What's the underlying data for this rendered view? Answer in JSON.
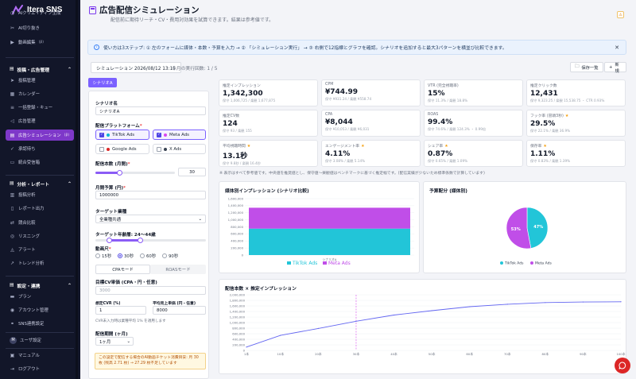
{
  "app": {
    "name": "Itera SNS"
  },
  "sidebar": {
    "top_items": [
      {
        "label": "AIクリエイティブ生成",
        "icon": "chat-icon"
      },
      {
        "label": "AI切り抜き",
        "icon": "scissors-icon"
      },
      {
        "label": "動画編集",
        "badge": "β",
        "icon": "video-icon"
      }
    ],
    "section1": {
      "label": "投稿・広告管理",
      "items": [
        {
          "label": "投稿管理",
          "icon": "send-icon"
        },
        {
          "label": "カレンダー",
          "icon": "calendar-icon"
        },
        {
          "label": "一括登録・キュー",
          "icon": "list-icon"
        },
        {
          "label": "広告管理",
          "icon": "megaphone-icon"
        },
        {
          "label": "広告シミュレーション",
          "badge": "β",
          "icon": "calculator-icon",
          "active": true
        },
        {
          "label": "承認待ち",
          "icon": "check-icon"
        },
        {
          "label": "統合受信箱",
          "icon": "inbox-icon"
        }
      ]
    },
    "section2": {
      "label": "分析・レポート",
      "items": [
        {
          "label": "投稿分析",
          "icon": "chart-icon"
        },
        {
          "label": "レポート出力",
          "icon": "file-icon"
        },
        {
          "label": "競合比較",
          "icon": "compare-icon"
        },
        {
          "label": "リスニング",
          "icon": "ear-icon"
        },
        {
          "label": "アラート",
          "icon": "bell-icon"
        },
        {
          "label": "トレンド分析",
          "icon": "trend-icon"
        }
      ]
    },
    "section3": {
      "label": "設定・連携",
      "items": [
        {
          "label": "プラン",
          "icon": "card-icon"
        },
        {
          "label": "アカウント管理",
          "icon": "user-icon"
        },
        {
          "label": "SNS連携設定",
          "icon": "link-icon"
        }
      ]
    },
    "user": {
      "initial": "M",
      "label": "ユーザ設定"
    },
    "bottom": [
      {
        "label": "マニュアル",
        "icon": "book-icon"
      },
      {
        "label": "ログアウト",
        "icon": "logout-icon"
      }
    ]
  },
  "header": {
    "title": "広告配信シミュレーション",
    "subtitle": "配信前に期待リーチ・CV・費用対効果を試算できます。結果は参考値です。"
  },
  "info": {
    "text": "使い方は3ステップ: ① 左のフォームに媒体・本数・予算を入力 → ② 「シミュレーション実行」 → ③ 右側で12指標とグラフを確認。シナリオを追加すると最大3パターンを横並び比較できます。"
  },
  "toolbar": {
    "sim_name": "シミュレーション 2026/08/12 13:15",
    "exec_count": "今月の実行回数: 1 / 5",
    "save": "保存一覧",
    "new": "新規"
  },
  "scenario_tab": "シナリオA",
  "form": {
    "scenario_name_label": "シナリオ名",
    "scenario_name": "シナリオA",
    "platform_label": "配信プラットフォーム",
    "platforms": [
      {
        "name": "TikTok Ads",
        "checked": true,
        "color": "#06b6d4"
      },
      {
        "name": "Meta Ads",
        "checked": true,
        "color": "#d946ef"
      },
      {
        "name": "Google Ads",
        "checked": false,
        "color": "#dc2626"
      },
      {
        "name": "X Ads",
        "checked": false,
        "color": "#374151"
      }
    ],
    "count_label": "配信本数 (月間)",
    "count_value": "30",
    "count_level": 0.3,
    "budget_label": "月間予算 (円)",
    "budget_value": "1000000",
    "industry_label": "ターゲット業種",
    "industry_value": "全業種共通",
    "age_label": "ターゲット年齢層: 24〜44歳",
    "age_range": [
      0.12,
      0.4
    ],
    "duration_label": "動画尺",
    "durations": [
      "15秒",
      "30秒",
      "60秒",
      "90秒"
    ],
    "duration_selected": "30秒",
    "modes": [
      "CPAモード",
      "ROASモード"
    ],
    "target_cv_label": "目標CV単価 (CPA・円・任意)",
    "target_cv_placeholder": "3000",
    "cvr_label": "想定CVR (%)",
    "cvr_value": "1",
    "order_label": "平均売上単価 (円・任意)",
    "order_value": "8000",
    "cvr_note": "CVR未入力時は業種平均 1% を適用します",
    "period_label": "配信期間 (ヶ月)",
    "period_value": "1ヶ月",
    "warning": "この設定で配信する場合のAI動画チケット消費目安: 月 30 枚 (残高 2.71 枚) → 27.29 枚不足しています"
  },
  "metrics": [
    {
      "label": "推定インプレッション",
      "value": "1,342,300",
      "sub": "保守 1,006,725 / 楽観 1,677,875",
      "star": false
    },
    {
      "label": "CPM",
      "value": "¥744.99",
      "sub": "保守 ¥931.24 / 楽観 ¥558.74",
      "star": false
    },
    {
      "label": "VTR (完全視聴率)",
      "value": "15%",
      "sub": "保守 11.3% / 楽観 18.8%",
      "star": false
    },
    {
      "label": "推定クリック数",
      "value": "12,431",
      "sub": "保守 9,323.25 / 楽観 15,538.75 ・ CTR 0.93%",
      "star": false
    },
    {
      "label": "推定CV数",
      "value": "124",
      "sub": "保守 93 / 楽観 155",
      "star": false
    },
    {
      "label": "CPA",
      "value": "¥8,044",
      "sub": "保守 ¥10,053 / 楽観 ¥6,031",
      "star": false
    },
    {
      "label": "ROAS",
      "value": "99.4%",
      "sub": "保守 74.6% / 楽観 124.3% ・ 0.99倍",
      "star": false
    },
    {
      "label": "フック率 (冒頭3秒)",
      "value": "29.5%",
      "sub": "保守 22.1% / 楽観 36.9%",
      "star": true
    },
    {
      "label": "平均視聴時間",
      "value": "13.1秒",
      "sub": "保守 9.8秒 / 楽観 16.4秒",
      "star": true
    },
    {
      "label": "エンゲージメント率",
      "value": "4.11%",
      "sub": "保守 3.08% / 楽観 5.14%",
      "star": true
    },
    {
      "label": "シェア率",
      "value": "0.87%",
      "sub": "保守 0.65% / 楽観 1.09%",
      "star": true
    },
    {
      "label": "保存率",
      "value": "1.11%",
      "sub": "保守 0.83% / 楽観 1.39%",
      "star": true
    }
  ],
  "disclaimer": "※ 表示はすべて参考値です。中央値を推奨値とし、保守値〜楽観値はベンチマークに基づく推定幅です。(配信実績が少ないため標準係数で計算しています)",
  "charts": {
    "bar": {
      "title": "媒体別インプレッション (シナリオ比較)",
      "chart_data": {
        "type": "bar",
        "stacked": true,
        "categories": [
          "シナリオA"
        ],
        "series": [
          {
            "name": "TikTok Ads",
            "color": "#22c5d8",
            "values": [
              750000
            ]
          },
          {
            "name": "Meta Ads",
            "color": "#c04ee8",
            "values": [
              592300
            ]
          }
        ],
        "ylim": [
          0,
          1600000
        ],
        "yticks": [
          "0",
          "200,000",
          "400,000",
          "600,000",
          "800,000",
          "1,000,000",
          "1,200,000",
          "1,400,000",
          "1,600,000"
        ]
      }
    },
    "pie": {
      "title": "予算配分 (媒体別)",
      "chart_data": {
        "type": "pie",
        "slices": [
          {
            "name": "TikTok Ads",
            "value": 47,
            "label": "47%",
            "color": "#22c5d8"
          },
          {
            "name": "Meta Ads",
            "value": 53,
            "label": "53%",
            "color": "#c04ee8"
          }
        ]
      }
    },
    "line": {
      "title": "配信本数 × 推定インプレッション",
      "chart_data": {
        "type": "line",
        "x": [
          1,
          10,
          20,
          30,
          40,
          50,
          60,
          70,
          80,
          90,
          100
        ],
        "y": [
          120000,
          540000,
          790000,
          1050000,
          1270000,
          1430000,
          1570000,
          1660000,
          1720000,
          1740000,
          1750000
        ],
        "marker_x": 30,
        "ylim": [
          0,
          2000000
        ],
        "yticks": [
          "0",
          "200,000",
          "400,000",
          "600,000",
          "800,000",
          "1,000,000",
          "1,200,000",
          "1,400,000",
          "1,600,000",
          "1,800,000",
          "2,000,000"
        ],
        "xticks": [
          "1本",
          "10本",
          "20本",
          "30本",
          "40本",
          "50本",
          "60本",
          "70本",
          "80本",
          "90本",
          "100本"
        ]
      }
    }
  }
}
